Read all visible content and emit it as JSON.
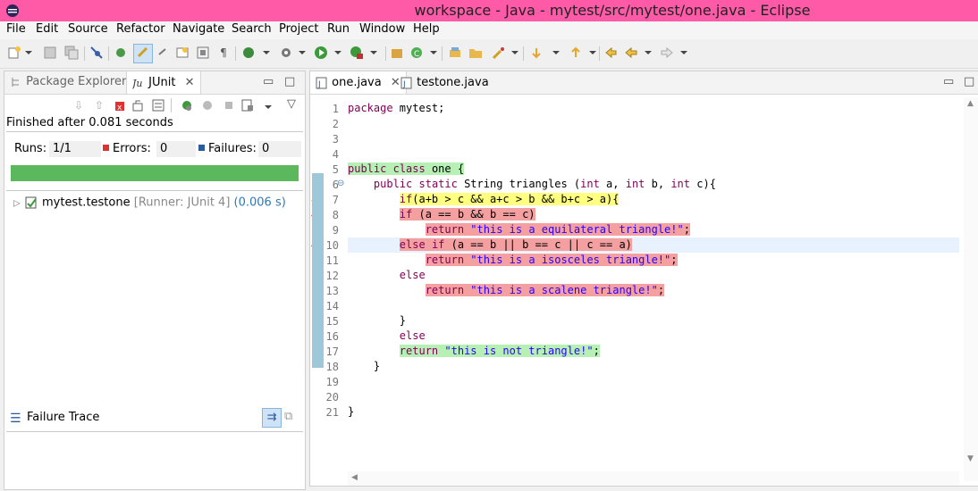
{
  "window": {
    "title": "workspace - Java - mytest/src/mytest/one.java - Eclipse"
  },
  "menu": [
    "File",
    "Edit",
    "Source",
    "Refactor",
    "Navigate",
    "Search",
    "Project",
    "Run",
    "Window",
    "Help"
  ],
  "left_panel": {
    "tabs": {
      "package_explorer": "Package Explorer",
      "junit": "JUnit"
    },
    "finished_text": "Finished after 0.081 seconds",
    "runs_label": "Runs:",
    "runs_value": "1/1",
    "errors_label": "Errors:",
    "errors_value": "0",
    "failures_label": "Failures:",
    "failures_value": "0",
    "progress": 1.0,
    "progress_color": "#5cb85c",
    "tree": {
      "name": "mytest.testone",
      "runner": "[Runner: JUnit 4]",
      "time": "(0.006 s)"
    },
    "failure_trace_label": "Failure Trace"
  },
  "editor": {
    "tabs": [
      {
        "label": "one.java",
        "active": true
      },
      {
        "label": "testone.java",
        "active": false
      }
    ],
    "highlight_colors": {
      "covered": "#b7f0b5",
      "partial": "#ffff80",
      "missed": "#f4a0a0"
    },
    "lines": [
      {
        "n": "1",
        "segments": [
          {
            "t": "package",
            "c": "kw"
          },
          {
            "t": " mytest;"
          }
        ]
      },
      {
        "n": "2",
        "segments": []
      },
      {
        "n": "3",
        "segments": []
      },
      {
        "n": "4",
        "segments": []
      },
      {
        "n": "5",
        "hl": "green",
        "segments": [
          {
            "t": "public",
            "c": "kw"
          },
          {
            "t": " "
          },
          {
            "t": "class",
            "c": "kw"
          },
          {
            "t": " one {"
          }
        ]
      },
      {
        "n": "6",
        "fold": true,
        "segments": [
          {
            "t": "    "
          },
          {
            "t": "public",
            "c": "kw"
          },
          {
            "t": " "
          },
          {
            "t": "static",
            "c": "kw"
          },
          {
            "t": " String triangles ("
          },
          {
            "t": "int",
            "c": "kw"
          },
          {
            "t": " a, "
          },
          {
            "t": "int",
            "c": "kw"
          },
          {
            "t": " b, "
          },
          {
            "t": "int",
            "c": "kw"
          },
          {
            "t": " c){"
          }
        ]
      },
      {
        "n": "7",
        "hl": "yellow",
        "marker": "yellow",
        "indent": "        ",
        "segments": [
          {
            "t": "if",
            "c": "kw"
          },
          {
            "t": "(a+b > c && a+c > b && b+c > a){"
          }
        ]
      },
      {
        "n": "8",
        "hl": "red",
        "marker": "red",
        "indent": "        ",
        "segments": [
          {
            "t": "if",
            "c": "kw"
          },
          {
            "t": " (a == b && b == c)"
          }
        ]
      },
      {
        "n": "9",
        "hl": "red",
        "indent": "            ",
        "segments": [
          {
            "t": "return",
            "c": "kw"
          },
          {
            "t": " "
          },
          {
            "t": "\"this is a equilateral triangle!\"",
            "c": "str"
          },
          {
            "t": ";"
          }
        ]
      },
      {
        "n": "10",
        "hl": "red",
        "marker": "red",
        "current": true,
        "indent": "        ",
        "segments": [
          {
            "t": "else",
            "c": "kw"
          },
          {
            "t": " "
          },
          {
            "t": "if",
            "c": "kw"
          },
          {
            "t": " (a == b || b == c || c == a)"
          }
        ]
      },
      {
        "n": "11",
        "hl": "red",
        "indent": "            ",
        "segments": [
          {
            "t": "return",
            "c": "kw"
          },
          {
            "t": " "
          },
          {
            "t": "\"this is a isosceles triangle!\"",
            "c": "str"
          },
          {
            "t": ";"
          }
        ]
      },
      {
        "n": "12",
        "indent": "        ",
        "segments": [
          {
            "t": "else",
            "c": "kw"
          }
        ]
      },
      {
        "n": "13",
        "hl": "red",
        "indent": "            ",
        "segments": [
          {
            "t": "return",
            "c": "kw"
          },
          {
            "t": " "
          },
          {
            "t": "\"this is a scalene triangle!\"",
            "c": "str"
          },
          {
            "t": ";"
          }
        ]
      },
      {
        "n": "14",
        "segments": []
      },
      {
        "n": "15",
        "indent": "        ",
        "segments": [
          {
            "t": "}"
          }
        ]
      },
      {
        "n": "16",
        "indent": "        ",
        "segments": [
          {
            "t": "else",
            "c": "kw"
          }
        ]
      },
      {
        "n": "17",
        "hl": "green",
        "indent": "        ",
        "segments": [
          {
            "t": "return",
            "c": "kw"
          },
          {
            "t": " "
          },
          {
            "t": "\"this is not triangle!\"",
            "c": "str"
          },
          {
            "t": ";"
          }
        ]
      },
      {
        "n": "18",
        "indent": "    ",
        "segments": [
          {
            "t": "}"
          }
        ]
      },
      {
        "n": "19",
        "segments": []
      },
      {
        "n": "20",
        "segments": []
      },
      {
        "n": "21",
        "segments": [
          {
            "t": "}"
          }
        ]
      }
    ]
  }
}
